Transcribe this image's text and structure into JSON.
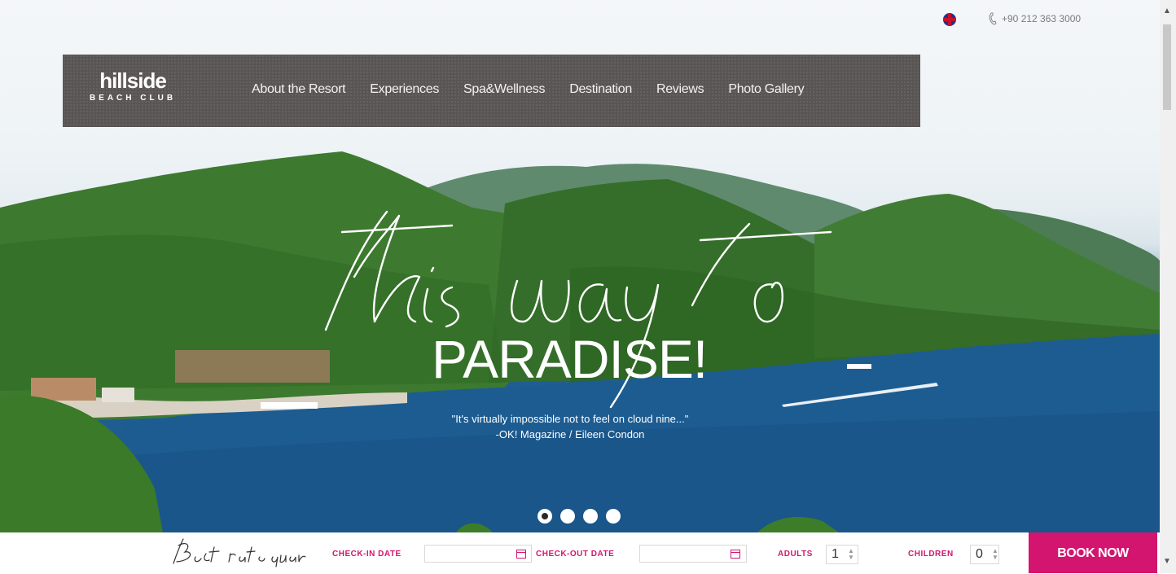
{
  "topbar": {
    "language_icon": "uk-flag-icon",
    "phone_icon": "phone-icon",
    "phone": "+90 212 363 3000"
  },
  "brand": {
    "name": "hillside",
    "sub": "BEACH CLUB"
  },
  "nav": {
    "items": [
      "About the Resort",
      "Experiences",
      "Spa&Wellness",
      "Destination",
      "Reviews",
      "Photo Gallery"
    ]
  },
  "hero": {
    "script_line": "this way to",
    "headline": "PARADISE!",
    "quote": "\"It's virtually impossible not to feel on cloud nine...\"",
    "attribution": "-OK! Magazine / Eileen Condon",
    "slides": {
      "count": 4,
      "active": 1
    }
  },
  "booking": {
    "best_rate": "Best rate guarantee",
    "checkin_label": "CHECK-IN DATE",
    "checkin_value": "",
    "checkout_label": "CHECK-OUT DATE",
    "checkout_value": "",
    "adults_label": "ADULTS",
    "adults_value": "1",
    "children_label": "CHILDREN",
    "children_value": "0",
    "book_label": "BOOK NOW",
    "accent_color": "#d4156f"
  }
}
